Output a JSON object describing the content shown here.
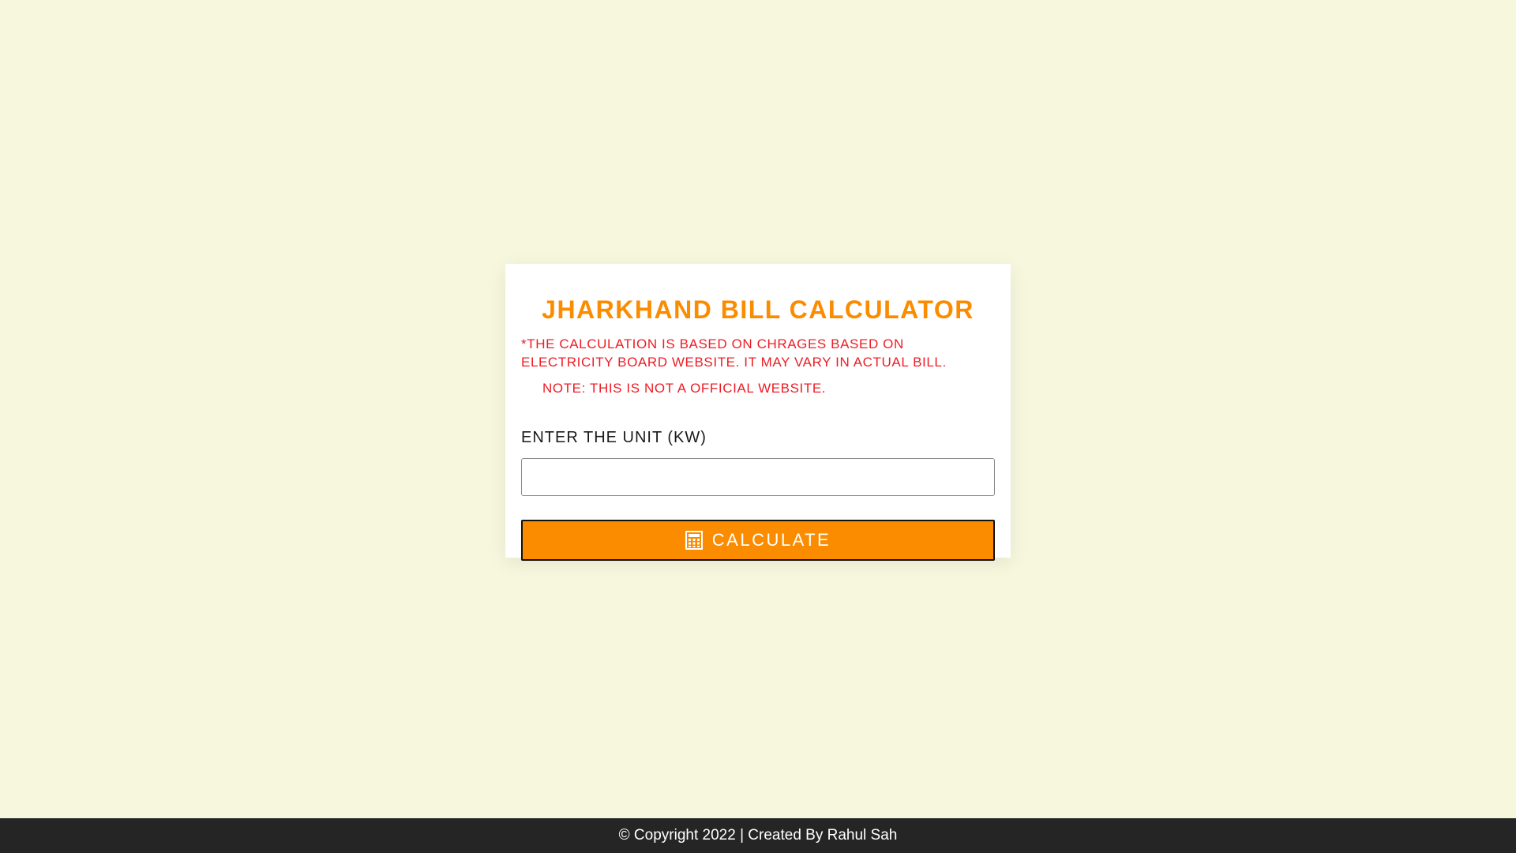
{
  "card": {
    "title": "Jharkhand Bill Calculator",
    "disclaimer": "*The calculation is based on chrages based on electricity board website. It may vary in actual bill.",
    "note": "Note: This is not a official website.",
    "unit_label": "Enter the unit (KW)",
    "unit_input": {
      "value": "",
      "placeholder": ""
    },
    "calculate_button": {
      "label": "Calculate",
      "icon": "calculator-icon"
    }
  },
  "footer": {
    "text": "© Copyright 2022 | Created By Rahul Sah"
  },
  "colors": {
    "page_background": "#f7f7de",
    "accent_orange": "#fb8c00",
    "warning_red": "#ed1c24",
    "footer_background": "#252525"
  }
}
